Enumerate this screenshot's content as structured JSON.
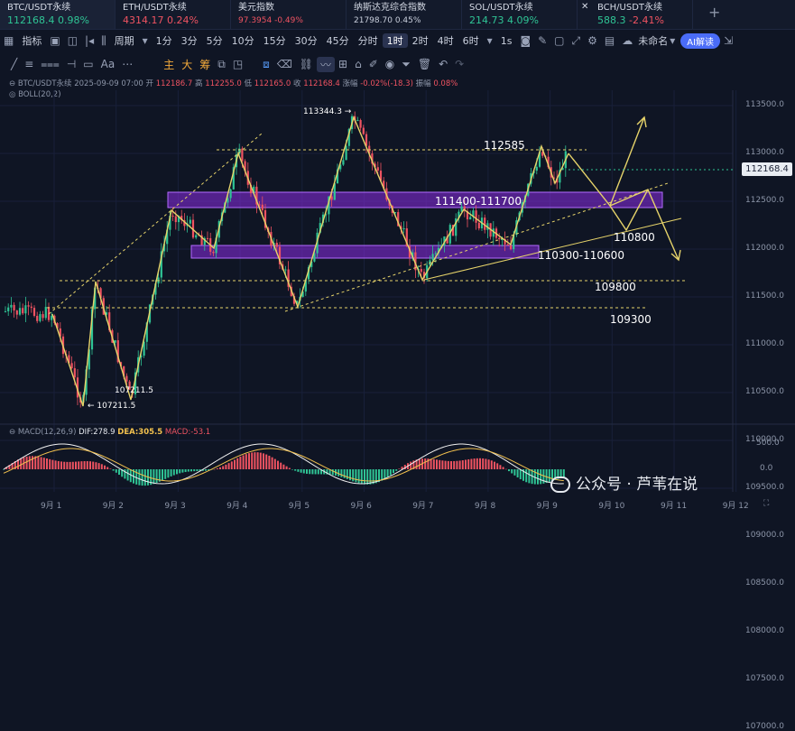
{
  "tabs": [
    {
      "name": "BTC/USDT永续",
      "price": "112168.4",
      "change": "0.98%",
      "dir": "up"
    },
    {
      "name": "ETH/USDT永续",
      "price": "4314.17",
      "change": "0.24%",
      "dir": "down"
    },
    {
      "name": "美元指数",
      "price": "97.3954",
      "change": "-0.49%",
      "dir": "down"
    },
    {
      "name": "纳斯达克综合指数",
      "price": "21798.70",
      "change": "0.45%",
      "dir": "up"
    },
    {
      "name": "SOL/USDT永续",
      "price": "214.73",
      "change": "4.09%",
      "dir": "up"
    },
    {
      "name": "BCH/USDT永续",
      "price": "588.3",
      "change": "-2.41%",
      "dir": "down"
    }
  ],
  "toolbar": {
    "indicators": "指标",
    "period": "周期",
    "intervals": [
      "1分",
      "3分",
      "5分",
      "10分",
      "15分",
      "30分",
      "45分",
      "分时",
      "1时",
      "2时",
      "4时",
      "6时",
      "1s"
    ],
    "selected_interval": "1时",
    "unnamed": "未命名",
    "ai": "AI解读"
  },
  "drawtools": {
    "main": "主",
    "big": "大",
    "chip": "筹",
    "text": "Aa"
  },
  "info": {
    "symbol": "BTC/USDT永续",
    "time": "2025-09-09 07:00",
    "open_label": "开",
    "open": "112186.7",
    "high_label": "高",
    "high": "112255.0",
    "low_label": "低",
    "low": "112165.0",
    "close_label": "收",
    "close": "112168.4",
    "change_label": "涨幅",
    "change": "-0.02%(-18.3)",
    "amp_label": "振幅",
    "amp": "0.08%",
    "boll": "BOLL(20,2)"
  },
  "price_axis": [
    "113500.0",
    "113000.0",
    "112500.0",
    "112000.0",
    "111500.0",
    "111000.0",
    "110500.0",
    "110000.0",
    "109500.0",
    "109000.0",
    "108500.0",
    "108000.0",
    "107500.0",
    "107000.0"
  ],
  "current_price": "112168.4",
  "macd_axis": [
    "500.0",
    "0.0"
  ],
  "macd": {
    "title": "MACD(12,26,9)",
    "dif": "DIF:278.9",
    "dea": "DEA:305.5",
    "macd": "MACD:-53.1"
  },
  "dates": [
    "9月 1",
    "9月 2",
    "9月 3",
    "9月 4",
    "9月 5",
    "9月 6",
    "9月 7",
    "9月 8",
    "9月 9",
    "9月 10",
    "9月 11",
    "9月 12"
  ],
  "annotations": {
    "high": "113344.3 →",
    "low": "← 107211.5",
    "low_label2": "107211.5",
    "l112585": "112585",
    "zone_upper": "111400-111700",
    "l110800": "110800",
    "zone_lower": "110300-110600",
    "l109800": "109800",
    "l109300": "109300"
  },
  "watermark": "公众号 · 芦苇在说",
  "colors": {
    "up": "#2fc495",
    "down": "#ef5361",
    "zone": "#8a2be2",
    "guide": "#e6d36a"
  }
}
